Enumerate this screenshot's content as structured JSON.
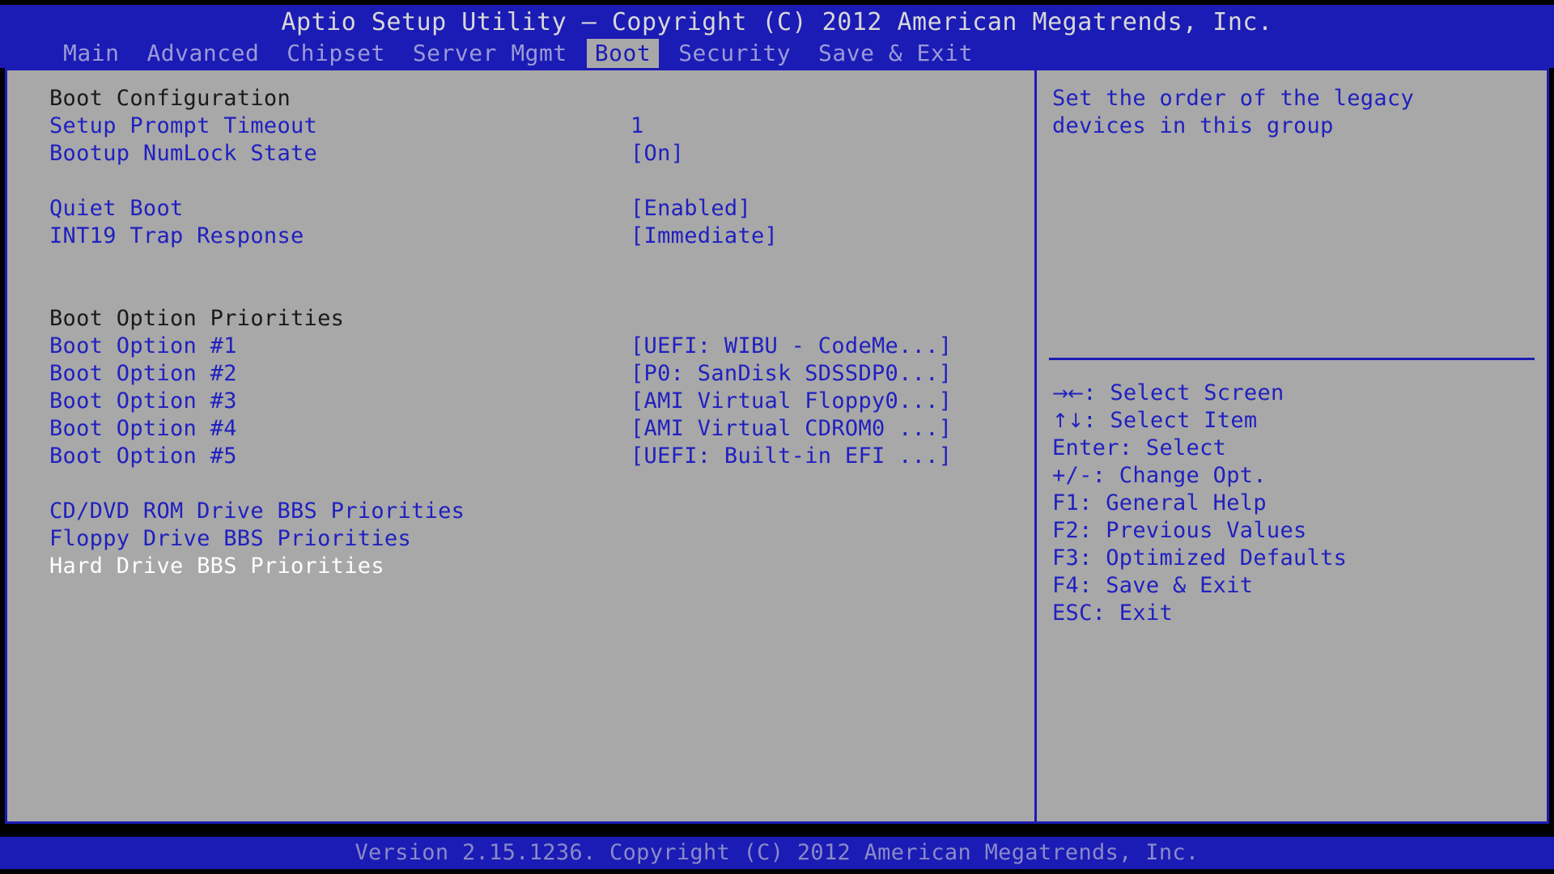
{
  "titlebar": {
    "text": "Aptio Setup Utility – Copyright (C) 2012 American Megatrends, Inc."
  },
  "menubar": {
    "items": [
      {
        "label": "Main",
        "active": false
      },
      {
        "label": "Advanced",
        "active": false
      },
      {
        "label": "Chipset",
        "active": false
      },
      {
        "label": "Server Mgmt",
        "active": false
      },
      {
        "label": "Boot",
        "active": true
      },
      {
        "label": "Security",
        "active": false
      },
      {
        "label": "Save & Exit",
        "active": false
      }
    ]
  },
  "main": {
    "rows": [
      {
        "kind": "header",
        "label": "Boot Configuration",
        "value": ""
      },
      {
        "kind": "item",
        "label": "Setup Prompt Timeout",
        "value": "1"
      },
      {
        "kind": "item",
        "label": "Bootup NumLock State",
        "value": "[On]"
      },
      {
        "kind": "spacer"
      },
      {
        "kind": "item",
        "label": "Quiet Boot",
        "value": "[Enabled]"
      },
      {
        "kind": "item",
        "label": "INT19 Trap Response",
        "value": "[Immediate]"
      },
      {
        "kind": "spacer"
      },
      {
        "kind": "spacer"
      },
      {
        "kind": "header",
        "label": "Boot Option Priorities",
        "value": ""
      },
      {
        "kind": "item",
        "label": "Boot Option #1",
        "value": "[UEFI: WIBU - CodeMe...]"
      },
      {
        "kind": "item",
        "label": "Boot Option #2",
        "value": "[P0: SanDisk SDSSDP0...]"
      },
      {
        "kind": "item",
        "label": "Boot Option #3",
        "value": "[AMI Virtual Floppy0...]"
      },
      {
        "kind": "item",
        "label": "Boot Option #4",
        "value": "[AMI Virtual CDROM0 ...]"
      },
      {
        "kind": "item",
        "label": "Boot Option #5",
        "value": "[UEFI: Built-in EFI ...]"
      },
      {
        "kind": "spacer"
      },
      {
        "kind": "item",
        "label": "CD/DVD ROM Drive BBS Priorities",
        "value": ""
      },
      {
        "kind": "item",
        "label": "Floppy Drive BBS Priorities",
        "value": ""
      },
      {
        "kind": "selected",
        "label": "Hard Drive BBS Priorities",
        "value": ""
      }
    ]
  },
  "help": {
    "description": "Set the order of the legacy\ndevices in this group",
    "keys": [
      {
        "glyph": "→←",
        "text": ": Select Screen"
      },
      {
        "glyph": "↑↓",
        "text": ": Select Item"
      },
      {
        "glyph": "",
        "text": "Enter: Select"
      },
      {
        "glyph": "",
        "text": "+/-: Change Opt."
      },
      {
        "glyph": "",
        "text": "F1: General Help"
      },
      {
        "glyph": "",
        "text": "F2: Previous Values"
      },
      {
        "glyph": "",
        "text": "F3: Optimized Defaults"
      },
      {
        "glyph": "",
        "text": "F4: Save & Exit"
      },
      {
        "glyph": "",
        "text": "ESC: Exit"
      }
    ]
  },
  "footer": {
    "text": "Version 2.15.1236. Copyright (C) 2012 American Megatrends, Inc."
  },
  "colors": {
    "bar_blue": "#1b1bb5",
    "panel_gray": "#a8a8a8",
    "text_blue": "#2020c0",
    "text_header": "#1a1a1a",
    "text_selected": "#ffffff",
    "menu_inactive": "#9a9ad8",
    "footer_text": "#8a8ac8"
  }
}
